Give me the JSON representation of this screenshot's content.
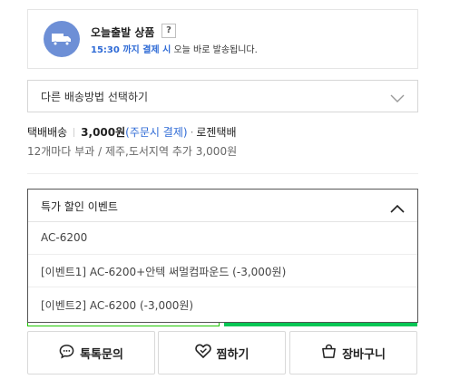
{
  "today_shipping": {
    "title": "오늘출발 상품",
    "help": "?",
    "subtitle_highlight": "15:30 까지 결제 시",
    "subtitle_rest": " 오늘 바로 발송됩니다."
  },
  "shipping_method_select": {
    "label": "다른 배송방법 선택하기"
  },
  "delivery": {
    "type": "택배배송",
    "price": "3,000원",
    "payment": "(주문시 결제)",
    "dot": "·",
    "carrier": "로젠택배",
    "note": "12개마다 부과 / 제주,도서지역 추가 3,000원"
  },
  "event_dropdown": {
    "label": "특가 할인 이벤트",
    "options": [
      "AC-6200",
      "[이벤트1] AC-6200+안텍 써멀컴파운드 (-3,000원)",
      "[이벤트2] AC-6200 (-3,000원)"
    ]
  },
  "actions": {
    "talk": "톡톡문의",
    "zzim": "찜하기",
    "cart": "장바구니"
  },
  "colors": {
    "accent_blue": "#2f6bd6",
    "truck_badge": "#6d8fd6",
    "buy_green": "#06c755"
  }
}
